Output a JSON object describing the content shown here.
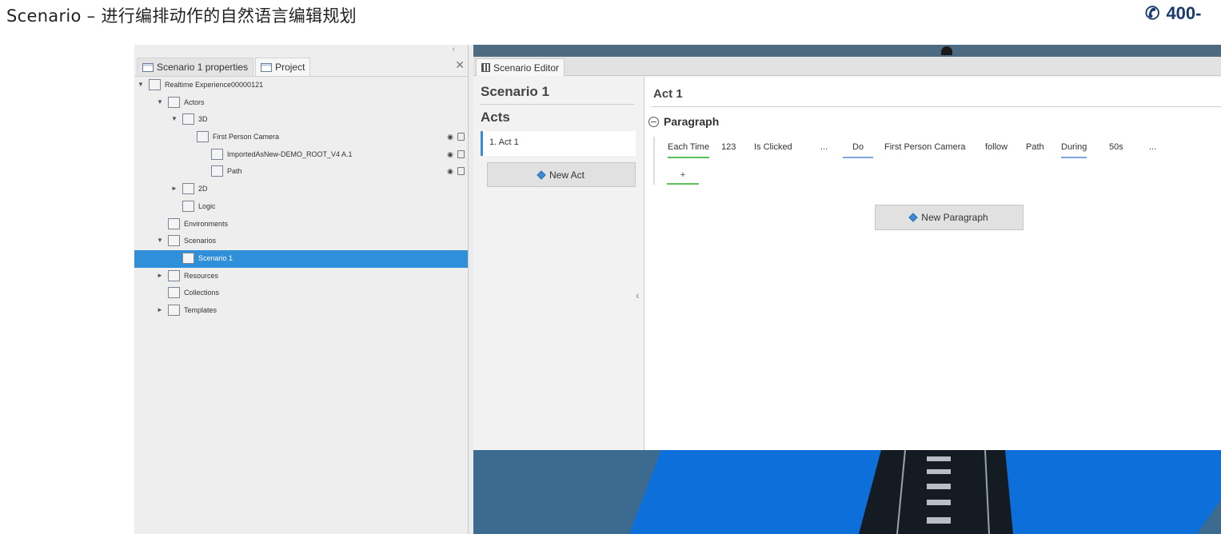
{
  "page": {
    "title": "Scenario – 进行编排动作的自然语言编辑规划",
    "phone": "400-"
  },
  "project_panel": {
    "tabs": [
      {
        "label": "Scenario 1 properties",
        "active": false
      },
      {
        "label": "Project",
        "active": true
      }
    ],
    "tree": [
      {
        "label": "Realtime Experience00000121",
        "arrow": "▼",
        "icon": "experience-icon"
      },
      {
        "label": "Actors",
        "arrow": "▼",
        "icon": "actor-icon"
      },
      {
        "label": "3D",
        "arrow": "▼",
        "icon": "3d-folder-icon"
      },
      {
        "label": "First Person Camera",
        "arrow": "",
        "icon": "camera-icon",
        "visible": true
      },
      {
        "label": "ImportedAsNew-DEMO_ROOT_V4 A.1",
        "arrow": "",
        "icon": "model-icon",
        "visible": true
      },
      {
        "label": "Path",
        "arrow": "",
        "icon": "path-icon",
        "visible": true
      },
      {
        "label": "2D",
        "arrow": "►",
        "icon": "2d-folder-icon"
      },
      {
        "label": "Logic",
        "arrow": "",
        "icon": "logic-icon"
      },
      {
        "label": "Environments",
        "arrow": "",
        "icon": "environment-icon"
      },
      {
        "label": "Scenarios",
        "arrow": "▼",
        "icon": "scenarios-icon"
      },
      {
        "label": "Scenario 1",
        "arrow": "",
        "icon": "scenario-icon",
        "selected": true
      },
      {
        "label": "Resources",
        "arrow": "►",
        "icon": "resources-icon"
      },
      {
        "label": "Collections",
        "arrow": "",
        "icon": "collections-icon"
      },
      {
        "label": "Templates",
        "arrow": "►",
        "icon": "templates-icon"
      }
    ]
  },
  "editor": {
    "tab_label": "Scenario Editor",
    "scenario_title": "Scenario 1",
    "acts_title": "Acts",
    "acts": [
      {
        "label": "1. Act 1"
      }
    ],
    "new_act_label": "New Act",
    "act_title": "Act 1",
    "paragraph_label": "Paragraph",
    "sentence": {
      "trigger": "Each Time",
      "object": "123",
      "event": "Is Clicked",
      "trigger_more": "...",
      "do": "Do",
      "actor": "First Person Camera",
      "verb": "follow",
      "target": "Path",
      "during": "During",
      "duration": "50s",
      "action_more": "..."
    },
    "add_label": "+",
    "new_paragraph_label": "New Paragraph"
  },
  "colors": {
    "selection": "#2f8fd8",
    "trigger_underline": "#5cbf5c",
    "action_underline": "#7aa7d8",
    "viewport_floor": "#0d6fd9",
    "viewport_sky": "#2f6f9c"
  }
}
